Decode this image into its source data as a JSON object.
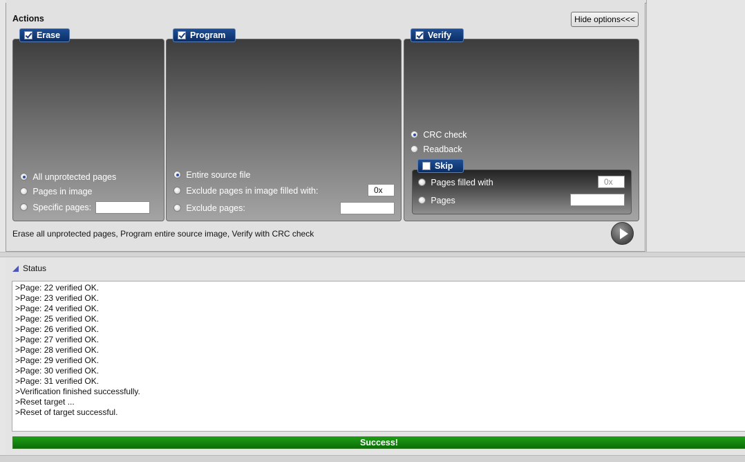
{
  "actions": {
    "title": "Actions",
    "hide_options_label": "Hide options<<<",
    "summary": "Erase all unprotected pages, Program entire source image, Verify with CRC check"
  },
  "erase": {
    "title": "Erase",
    "checked": true,
    "options": [
      "All unprotected pages",
      "Pages in image",
      "Specific pages:"
    ],
    "selected": "All unprotected pages",
    "specific_pages_value": ""
  },
  "program": {
    "title": "Program",
    "checked": true,
    "options": [
      "Entire source file",
      "Exclude pages in image filled with:",
      "Exclude pages:"
    ],
    "selected": "Entire source file",
    "fill_value": "0x",
    "exclude_pages_value": ""
  },
  "verify": {
    "title": "Verify",
    "checked": true,
    "options": [
      "CRC check",
      "Readback"
    ],
    "selected": "CRC check",
    "skip": {
      "title": "Skip",
      "checked": false,
      "options": [
        "Pages filled with",
        "Pages"
      ],
      "fill_value": "0x",
      "pages_value": ""
    }
  },
  "status": {
    "title": "Status",
    "log": [
      ">Page: 22 verified OK.",
      ">Page: 23 verified OK.",
      ">Page: 24 verified OK.",
      ">Page: 25 verified OK.",
      ">Page: 26 verified OK.",
      ">Page: 27 verified OK.",
      ">Page: 28 verified OK.",
      ">Page: 29 verified OK.",
      ">Page: 30 verified OK.",
      ">Page: 31 verified OK.",
      ">Verification finished successfully.",
      ">Reset target ...",
      ">Reset of target successful."
    ],
    "progress_label": "Success!",
    "progress_fraction": 1.0,
    "progress_color": "#0f8a0c"
  }
}
